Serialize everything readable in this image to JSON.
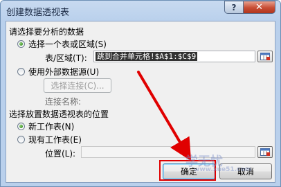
{
  "window": {
    "title": "创建数据透视表",
    "help_icon": "?",
    "close_icon": "✕"
  },
  "source_section": {
    "heading": "请选择要分析的数据",
    "option_table": {
      "label": "选择一个表或区域(S)",
      "selected": true
    },
    "range_label": "表/区域(T):",
    "range_value": "跳到合并单元格!$A$1:$C$9",
    "option_external": {
      "label": "使用外部数据源(U)",
      "selected": false
    },
    "choose_connection_button": "选择连接(C)...",
    "connection_name_label": "连接名称:"
  },
  "location_section": {
    "heading": "选择放置数据透视表的位置",
    "option_new": {
      "label": "新工作表(N)",
      "selected": true
    },
    "option_existing": {
      "label": "现有工作表(E)",
      "selected": false
    },
    "location_label": "位置(L):",
    "location_value": ""
  },
  "buttons": {
    "ok": "确定",
    "cancel": "取消"
  },
  "watermark": {
    "text": "学无忧",
    "domain": "www.xue51.com"
  },
  "annotation": {
    "arrow_color": "#e00000"
  }
}
